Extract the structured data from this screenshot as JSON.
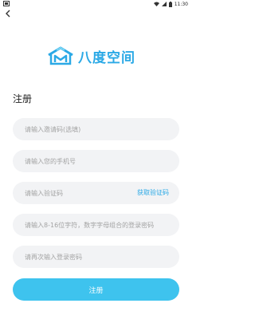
{
  "status_bar": {
    "time": "11:30"
  },
  "logo": {
    "text": "八度空间"
  },
  "page": {
    "title": "注册"
  },
  "form": {
    "invite_code": {
      "placeholder": "请输入邀请码(选填)"
    },
    "phone": {
      "placeholder": "请输入您的手机号"
    },
    "verify_code": {
      "placeholder": "请输入验证码",
      "action_label": "获取验证码"
    },
    "password": {
      "placeholder": "请输入8-16位字符，数字字母组合的登录密码"
    },
    "confirm_password": {
      "placeholder": "请再次输入登录密码"
    }
  },
  "submit": {
    "label": "注册"
  },
  "colors": {
    "accent": "#2ba9e6",
    "button": "#3ec3ee",
    "field_bg": "#f2f3f5"
  }
}
